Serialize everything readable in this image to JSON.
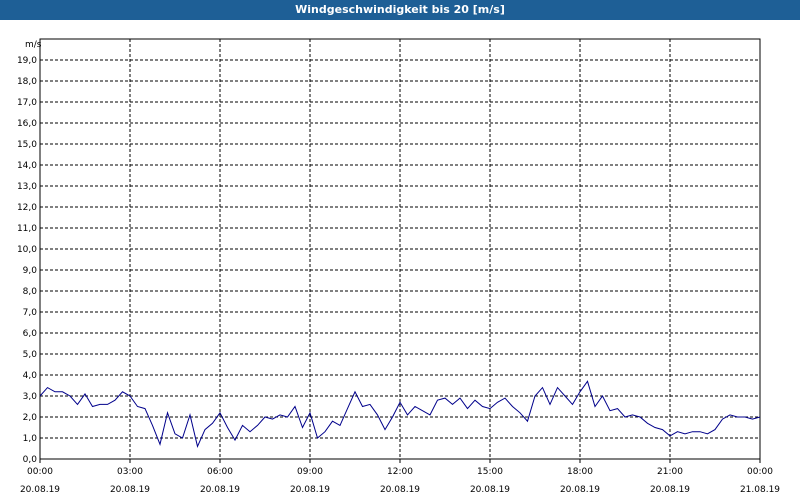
{
  "window": {
    "title": "Windgeschwindigkeit bis 20 [m/s]",
    "title_bar_color": "#1e5f96"
  },
  "chart_data": {
    "type": "line",
    "title": "Windgeschwindigkeit bis 20 [m/s]",
    "ylabel": "m/s",
    "xlabel": "",
    "ylim": [
      0,
      20
    ],
    "y_ticks": [
      "0,0",
      "1,0",
      "2,0",
      "3,0",
      "4,0",
      "5,0",
      "6,0",
      "7,0",
      "8,0",
      "9,0",
      "10,0",
      "11,0",
      "12,0",
      "13,0",
      "14,0",
      "15,0",
      "16,0",
      "17,0",
      "18,0",
      "19,0"
    ],
    "x_ticks": [
      {
        "time": "00:00",
        "date": "20.08.19"
      },
      {
        "time": "03:00",
        "date": "20.08.19"
      },
      {
        "time": "06:00",
        "date": "20.08.19"
      },
      {
        "time": "09:00",
        "date": "20.08.19"
      },
      {
        "time": "12:00",
        "date": "20.08.19"
      },
      {
        "time": "15:00",
        "date": "20.08.19"
      },
      {
        "time": "18:00",
        "date": "20.08.19"
      },
      {
        "time": "21:00",
        "date": "20.08.19"
      },
      {
        "time": "00:00",
        "date": "21.08.19"
      }
    ],
    "grid": true,
    "line_color": "#00008b",
    "series": [
      {
        "x_hours": [
          0,
          0.25,
          0.5,
          0.75,
          1,
          1.25,
          1.5,
          1.75,
          2,
          2.25,
          2.5,
          2.75,
          3,
          3.25,
          3.5,
          3.75,
          4,
          4.25,
          4.5,
          4.75,
          5,
          5.25,
          5.5,
          5.75,
          6,
          6.25,
          6.5,
          6.75,
          7,
          7.25,
          7.5,
          7.75,
          8,
          8.25,
          8.5,
          8.75,
          9,
          9.25,
          9.5,
          9.75,
          10,
          10.25,
          10.5,
          10.75,
          11,
          11.25,
          11.5,
          11.75,
          12,
          12.25,
          12.5,
          12.75,
          13,
          13.25,
          13.5,
          13.75,
          14,
          14.25,
          14.5,
          14.75,
          15,
          15.25,
          15.5,
          15.75,
          16,
          16.25,
          16.5,
          16.75,
          17,
          17.25,
          17.5,
          17.75,
          18,
          18.25,
          18.5,
          18.75,
          19,
          19.25,
          19.5,
          19.75,
          20,
          20.25,
          20.5,
          20.75,
          21,
          21.25,
          21.5,
          21.75,
          22,
          22.25,
          22.5,
          22.75,
          23,
          23.25,
          23.5,
          23.75,
          24
        ],
        "values": [
          3.0,
          3.4,
          3.2,
          3.2,
          3.0,
          2.6,
          3.1,
          2.5,
          2.6,
          2.6,
          2.8,
          3.2,
          3.0,
          2.5,
          2.4,
          1.6,
          0.7,
          2.2,
          1.2,
          1.0,
          2.1,
          0.6,
          1.4,
          1.7,
          2.2,
          1.5,
          0.9,
          1.6,
          1.3,
          1.6,
          2.0,
          1.9,
          2.1,
          2.0,
          2.5,
          1.5,
          2.2,
          1.0,
          1.3,
          1.8,
          1.6,
          2.4,
          3.2,
          2.5,
          2.6,
          2.1,
          1.4,
          2.0,
          2.7,
          2.1,
          2.5,
          2.3,
          2.1,
          2.8,
          2.9,
          2.6,
          2.9,
          2.4,
          2.8,
          2.5,
          2.4,
          2.7,
          2.9,
          2.5,
          2.2,
          1.8,
          3.0,
          3.4,
          2.6,
          3.4,
          3.0,
          2.6,
          3.2,
          3.7,
          2.5,
          3.0,
          2.3,
          2.4,
          2.0,
          2.1,
          2.0,
          1.7,
          1.5,
          1.4,
          1.1,
          1.3,
          1.2,
          1.3,
          1.3,
          1.2,
          1.4,
          1.9,
          2.1,
          2.0,
          2.0,
          1.9,
          2.0
        ]
      }
    ]
  }
}
